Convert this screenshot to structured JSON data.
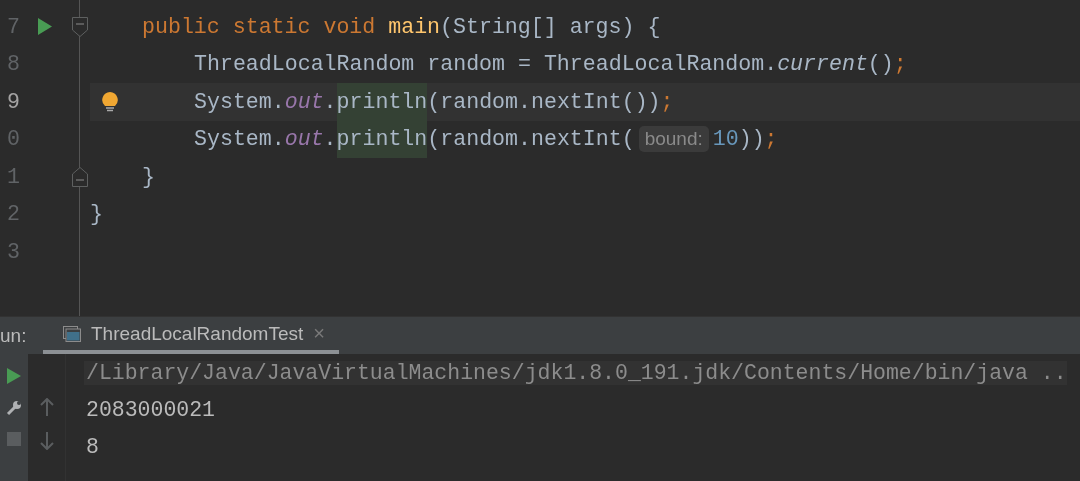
{
  "editor": {
    "lines": [
      {
        "number": "7",
        "kind": "method",
        "run": true,
        "fold_start": true,
        "fold_end": false,
        "current": false,
        "bulb": false,
        "tokens": [
          {
            "kind": "keyword",
            "text": "public static void "
          },
          {
            "kind": "method",
            "text": "main"
          },
          {
            "kind": "plain",
            "text": "(String[] args) {"
          }
        ]
      },
      {
        "number": "8",
        "kind": "statement",
        "run": false,
        "fold_start": false,
        "fold_end": false,
        "current": false,
        "bulb": false,
        "tokens": [
          {
            "kind": "plain",
            "text": "ThreadLocalRandom random = ThreadLocalRandom."
          },
          {
            "kind": "static-call",
            "text": "current"
          },
          {
            "kind": "plain",
            "text": "()"
          },
          {
            "kind": "keyword",
            "text": ";"
          }
        ]
      },
      {
        "number": "9",
        "kind": "statement",
        "run": false,
        "fold_start": false,
        "fold_end": false,
        "current": true,
        "bulb": true,
        "tokens": [
          {
            "kind": "plain",
            "text": "System."
          },
          {
            "kind": "static-field",
            "text": "out"
          },
          {
            "kind": "plain",
            "text": "."
          },
          {
            "kind": "match",
            "text": "println"
          },
          {
            "kind": "plain",
            "text": "(random.nextInt())"
          },
          {
            "kind": "keyword",
            "text": ";"
          }
        ]
      },
      {
        "number": "0",
        "kind": "statement",
        "run": false,
        "fold_start": false,
        "fold_end": false,
        "current": false,
        "bulb": false,
        "tokens": [
          {
            "kind": "plain",
            "text": "System."
          },
          {
            "kind": "static-field",
            "text": "out"
          },
          {
            "kind": "plain",
            "text": "."
          },
          {
            "kind": "match",
            "text": "println"
          },
          {
            "kind": "plain",
            "text": "(random.nextInt("
          },
          {
            "kind": "hint",
            "text": "bound:"
          },
          {
            "kind": "number",
            "text": "10"
          },
          {
            "kind": "plain",
            "text": "))"
          },
          {
            "kind": "keyword",
            "text": ";"
          }
        ]
      },
      {
        "number": "1",
        "kind": "method",
        "run": false,
        "fold_start": false,
        "fold_end": true,
        "current": false,
        "bulb": false,
        "tokens": [
          {
            "kind": "plain",
            "text": "}"
          }
        ]
      },
      {
        "number": "2",
        "kind": "class",
        "run": false,
        "fold_start": false,
        "fold_end": false,
        "current": false,
        "bulb": false,
        "tokens": [
          {
            "kind": "plain",
            "text": "}"
          }
        ]
      },
      {
        "number": "3",
        "kind": "class",
        "run": false,
        "fold_start": false,
        "fold_end": false,
        "current": false,
        "bulb": false
      }
    ]
  },
  "run_panel": {
    "label": "un:",
    "tab": {
      "title": "ThreadLocalRandomTest",
      "selected": true,
      "close": "×"
    },
    "console": [
      {
        "kind": "command",
        "text": "/Library/Java/JavaVirtualMachines/jdk1.8.0_191.jdk/Contents/Home/bin/java .."
      },
      {
        "kind": "output",
        "text": "2083000021"
      },
      {
        "kind": "output",
        "text": "8"
      }
    ]
  }
}
